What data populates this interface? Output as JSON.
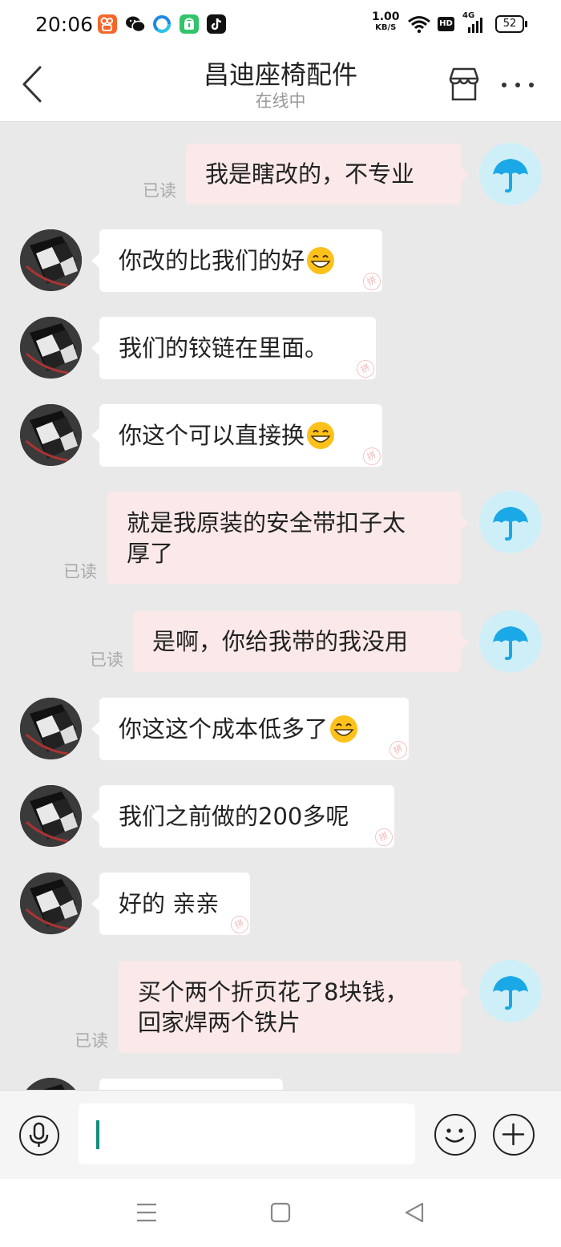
{
  "status_bar": {
    "time": "20:06",
    "net_speed_value": "1.00",
    "net_speed_unit": "KB/S",
    "hd_label": "HD",
    "signal_label": "4G",
    "battery": "52",
    "app_icons": [
      "kuaishou-icon",
      "wechat-icon",
      "browser-icon",
      "market-icon",
      "tiktok-icon"
    ]
  },
  "header": {
    "title": "昌迪座椅配件",
    "status": "在线中"
  },
  "messages": [
    {
      "side": "out",
      "text": "我是瞎改的，不专业",
      "read": "已读"
    },
    {
      "side": "in",
      "text": "你改的比我们的好",
      "emoji": "grin-emoji"
    },
    {
      "side": "in",
      "text": "我们的铰链在里面。"
    },
    {
      "side": "in",
      "text": "你这个可以直接换",
      "emoji": "grin-emoji"
    },
    {
      "side": "out",
      "line1": "就是我原装的安全带扣子太",
      "line2": "厚了",
      "read": "已读"
    },
    {
      "side": "out",
      "text": "是啊，你给我带的我没用",
      "read": "已读"
    },
    {
      "side": "in",
      "text": "你这这个成本低多了",
      "emoji": "grin-emoji"
    },
    {
      "side": "in",
      "text": "我们之前做的200多呢"
    },
    {
      "side": "in",
      "text": "好的 亲亲"
    },
    {
      "side": "out",
      "line1": "买个两个折页花了8块钱，",
      "line2": "回家焊两个铁片",
      "read": "已读"
    }
  ],
  "input": {
    "value": "",
    "placeholder": ""
  },
  "colors": {
    "out_bubble": "#fbe9e9",
    "in_bubble": "#ffffff",
    "background": "#e9e9e9",
    "caret": "#138d7a",
    "umbrella": "#1aa9e6"
  }
}
